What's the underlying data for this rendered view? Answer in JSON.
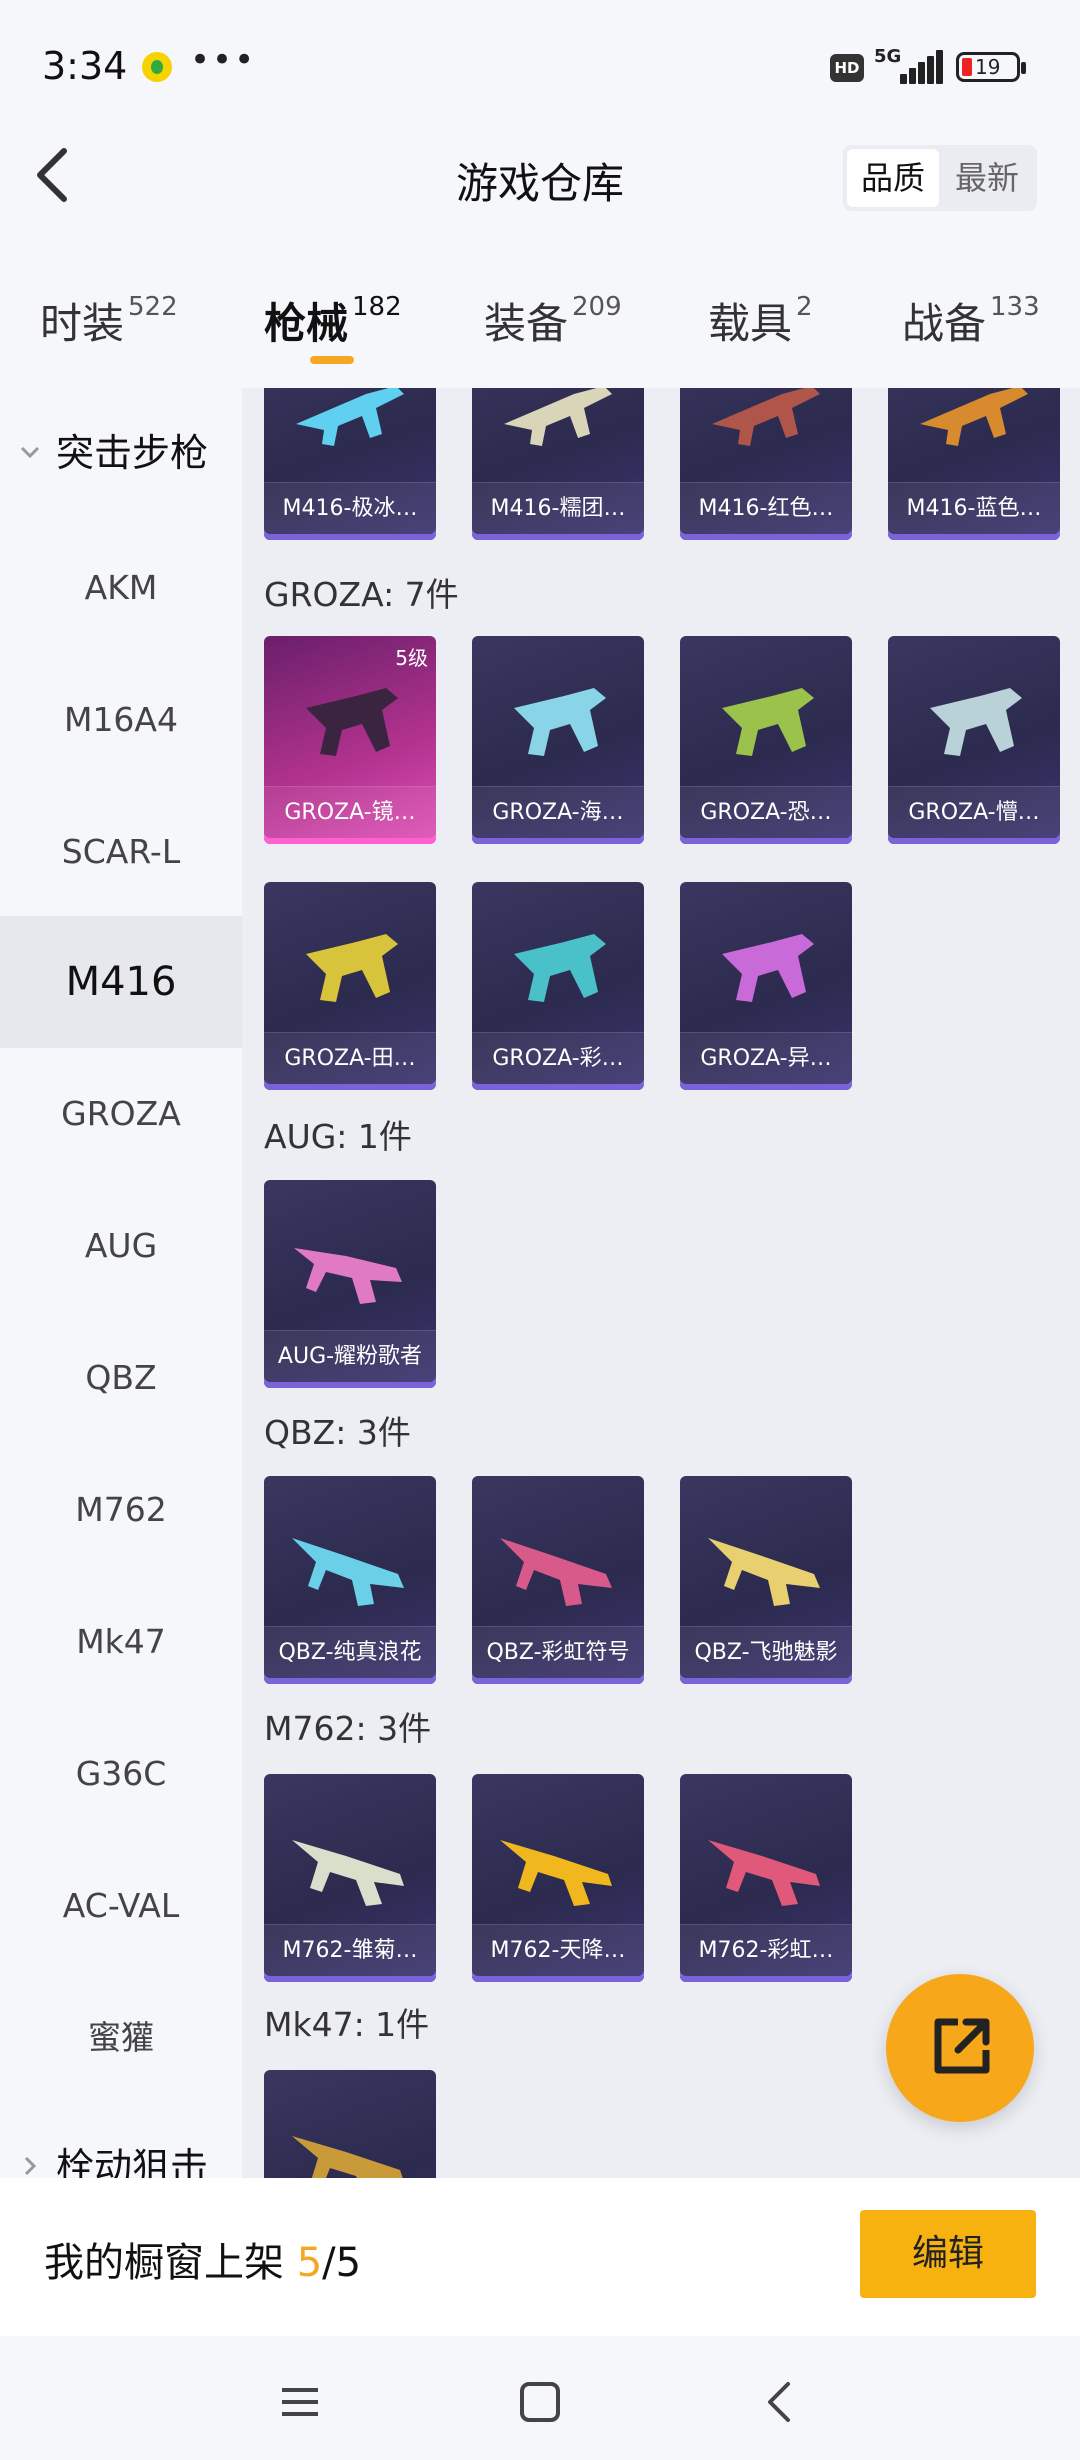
{
  "status": {
    "time": "3:34",
    "more": "•••",
    "hd": "HD",
    "network": "5G",
    "battery": "19"
  },
  "header": {
    "title": "游戏仓库",
    "sort_quality": "品质",
    "sort_latest": "最新"
  },
  "tabs": [
    {
      "label": "时装",
      "count": "522"
    },
    {
      "label": "枪械",
      "count": "182"
    },
    {
      "label": "装备",
      "count": "209"
    },
    {
      "label": "载具",
      "count": "2"
    },
    {
      "label": "战备",
      "count": "133"
    }
  ],
  "sidebar": {
    "group": "突击步枪",
    "items": [
      "AKM",
      "M16A4",
      "SCAR-L",
      "M416",
      "GROZA",
      "AUG",
      "QBZ",
      "M762",
      "Mk47",
      "G36C",
      "AC-VAL",
      "蜜獾"
    ],
    "active": "M416",
    "next_group": "栓动狙击"
  },
  "sections": {
    "m416_items": [
      "M416-极冰…",
      "M416-糯团…",
      "M416-红色…",
      "M416-蓝色…"
    ],
    "groza": {
      "label": "GROZA: 7件",
      "items": [
        "GROZA-镜…",
        "GROZA-海…",
        "GROZA-恐…",
        "GROZA-懵…",
        "GROZA-田…",
        "GROZA-彩…",
        "GROZA-异…"
      ],
      "level_badge": "5级"
    },
    "aug": {
      "label": "AUG: 1件",
      "items": [
        "AUG-耀粉歌者"
      ]
    },
    "qbz": {
      "label": "QBZ: 3件",
      "items": [
        "QBZ-纯真浪花",
        "QBZ-彩虹符号",
        "QBZ-飞驰魅影"
      ]
    },
    "m762": {
      "label": "M762: 3件",
      "items": [
        "M762-雏菊…",
        "M762-天降…",
        "M762-彩虹…"
      ]
    },
    "mk47": {
      "label": "Mk47: 1件"
    }
  },
  "bottom": {
    "label_prefix": "我的橱窗上架 ",
    "count": "5",
    "label_suffix": "/5",
    "edit": "编辑"
  },
  "colors": {
    "accent": "#f5a623",
    "card_bg": "#2c2a4e",
    "card_rare": "#e052b8"
  }
}
